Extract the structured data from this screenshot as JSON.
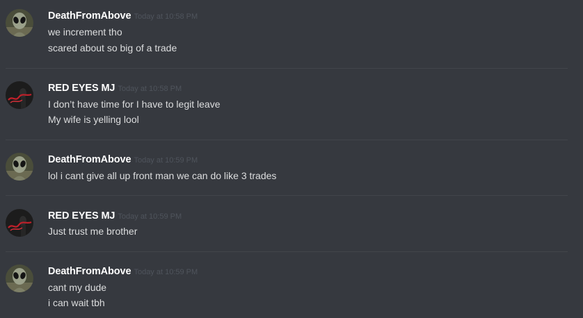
{
  "messages": [
    {
      "author": "DeathFromAbove",
      "timestamp": "Today at 10:58 PM",
      "avatar_icon": "alien-icon",
      "lines": [
        "we increment tho",
        "scared about so big of a trade"
      ]
    },
    {
      "author": "RED EYES MJ",
      "timestamp": "Today at 10:58 PM",
      "avatar_icon": "red-script-portrait-icon",
      "lines": [
        "I don’t have time for I have to legit leave",
        "My wife is yelling lool"
      ]
    },
    {
      "author": "DeathFromAbove",
      "timestamp": "Today at 10:59 PM",
      "avatar_icon": "alien-icon",
      "lines": [
        "lol i cant give all up front man we can do like 3 trades"
      ]
    },
    {
      "author": "RED EYES MJ",
      "timestamp": "Today at 10:59 PM",
      "avatar_icon": "red-script-portrait-icon",
      "lines": [
        "Just trust me brother"
      ]
    },
    {
      "author": "DeathFromAbove",
      "timestamp": "Today at 10:59 PM",
      "avatar_icon": "alien-icon",
      "lines": [
        "cant my dude",
        "i can wait tbh"
      ]
    }
  ],
  "colors": {
    "background": "#36393f",
    "username": "#ffffff",
    "timestamp": "#4f545c",
    "message_text": "#dcddde",
    "divider": "#42454a"
  }
}
